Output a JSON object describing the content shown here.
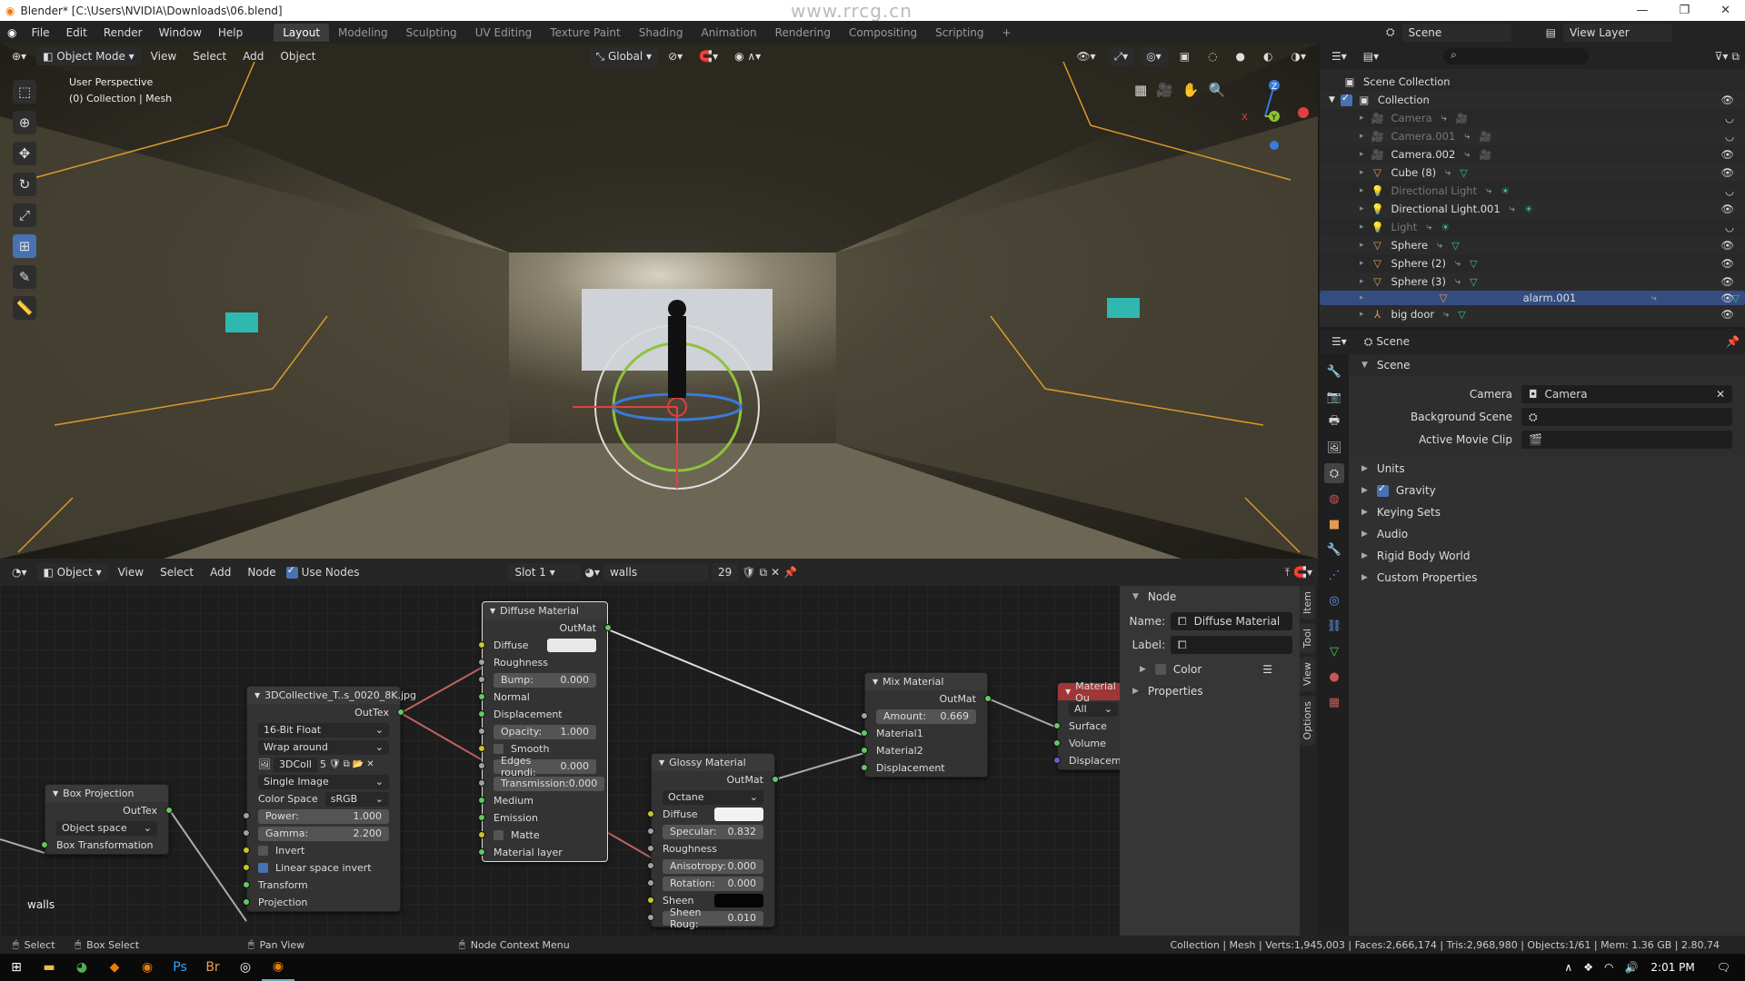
{
  "window": {
    "title": "Blender* [C:\\Users\\NVIDIA\\Downloads\\06.blend]",
    "watermark": "www.rrcg.cn"
  },
  "menu": [
    "File",
    "Edit",
    "Render",
    "Window",
    "Help"
  ],
  "workspaces": [
    "Layout",
    "Modeling",
    "Sculpting",
    "UV Editing",
    "Texture Paint",
    "Shading",
    "Animation",
    "Rendering",
    "Compositing",
    "Scripting",
    "+"
  ],
  "active_workspace": "Layout",
  "scene_selector": "Scene",
  "view_layer": "View Layer",
  "viewport": {
    "mode": "Object Mode",
    "menus": [
      "View",
      "Select",
      "Add",
      "Object"
    ],
    "orientation": "Global",
    "overlay_line1": "User Perspective",
    "overlay_line2": "(0) Collection | Mesh",
    "axes": {
      "x": "X",
      "y": "Y",
      "z": "Z"
    }
  },
  "outliner": {
    "root": "Scene Collection",
    "collection": "Collection",
    "items": [
      {
        "name": "Camera",
        "icon": "camera",
        "dim": true,
        "visible": false
      },
      {
        "name": "Camera.001",
        "icon": "camera",
        "dim": true,
        "visible": false
      },
      {
        "name": "Camera.002",
        "icon": "camera",
        "dim": false,
        "visible": true
      },
      {
        "name": "Cube (8)",
        "icon": "mesh",
        "dim": false,
        "visible": true
      },
      {
        "name": "Directional Light",
        "icon": "light",
        "dim": true,
        "visible": false
      },
      {
        "name": "Directional Light.001",
        "icon": "light",
        "dim": false,
        "visible": true
      },
      {
        "name": "Light",
        "icon": "light",
        "dim": true,
        "visible": false
      },
      {
        "name": "Sphere",
        "icon": "mesh",
        "dim": false,
        "visible": true
      },
      {
        "name": "Sphere (2)",
        "icon": "mesh",
        "dim": false,
        "visible": true
      },
      {
        "name": "Sphere (3)",
        "icon": "mesh",
        "dim": false,
        "visible": true
      },
      {
        "name": "alarm.001",
        "icon": "mesh",
        "dim": false,
        "visible": true,
        "selected": true
      },
      {
        "name": "big door",
        "icon": "empty",
        "dim": false,
        "visible": true
      }
    ]
  },
  "properties": {
    "context": "Scene",
    "section": "Scene",
    "fields": [
      {
        "label": "Camera",
        "value": "Camera",
        "icon": "camera-object-icon"
      },
      {
        "label": "Background Scene",
        "value": "",
        "icon": "scene-icon"
      },
      {
        "label": "Active Movie Clip",
        "value": "",
        "icon": "clip-icon"
      }
    ],
    "panels": [
      {
        "label": "Units",
        "checkbox": false
      },
      {
        "label": "Gravity",
        "checkbox": true
      },
      {
        "label": "Keying Sets",
        "checkbox": false
      },
      {
        "label": "Audio",
        "checkbox": false
      },
      {
        "label": "Rigid Body World",
        "checkbox": false
      },
      {
        "label": "Custom Properties",
        "checkbox": false
      }
    ]
  },
  "node_editor": {
    "type": "Object",
    "menus": [
      "View",
      "Select",
      "Add",
      "Node"
    ],
    "use_nodes_label": "Use Nodes",
    "use_nodes": true,
    "slot": "Slot 1",
    "material": "walls",
    "users": "29",
    "material_label": "walls",
    "npanel": {
      "section": "Node",
      "name_label": "Name:",
      "name": "Diffuse Material",
      "label_label": "Label:",
      "label": "",
      "color": "Color",
      "properties": "Properties",
      "tabs": [
        "Item",
        "Tool",
        "View",
        "Options"
      ]
    },
    "nodes": [
      {
        "id": "diffuse",
        "title": "Diffuse Material",
        "active": true,
        "header_color": "#3a3a3a",
        "rows": [
          {
            "t": "out",
            "label": "OutMat",
            "sock": "#63c763"
          },
          {
            "t": "color",
            "label": "Diffuse",
            "color": "#e8e8e8",
            "sock": "#c7c729"
          },
          {
            "t": "socket",
            "label": "Roughness",
            "sock": "#a1a1a1"
          },
          {
            "t": "field",
            "label": "Bump:",
            "value": "0.000",
            "sock": "#a1a1a1"
          },
          {
            "t": "socket",
            "label": "Normal",
            "sock": "#63c763"
          },
          {
            "t": "socket",
            "label": "Displacement",
            "sock": "#63c763"
          },
          {
            "t": "field",
            "label": "Opacity:",
            "value": "1.000",
            "sock": "#a1a1a1"
          },
          {
            "t": "check",
            "label": "Smooth",
            "checked": false,
            "sock": "#c7c729"
          },
          {
            "t": "field",
            "label": "Edges roundi:",
            "value": "0.000",
            "sock": "#a1a1a1"
          },
          {
            "t": "field",
            "label": "Transmission:",
            "value": "0.000",
            "sock": "#a1a1a1"
          },
          {
            "t": "socket",
            "label": "Medium",
            "sock": "#63c763"
          },
          {
            "t": "socket",
            "label": "Emission",
            "sock": "#63c763"
          },
          {
            "t": "check",
            "label": "Matte",
            "checked": false,
            "sock": "#c7c729"
          },
          {
            "t": "socket",
            "label": "Material layer",
            "sock": "#63c763"
          }
        ]
      },
      {
        "id": "image",
        "title": "3DCollective_T..s_0020_8K.jpg",
        "header_color": "#3a3a3a",
        "rows": [
          {
            "t": "out",
            "label": "OutTex",
            "sock": "#63c763"
          },
          {
            "t": "select",
            "value": "16-Bit Float"
          },
          {
            "t": "select",
            "value": "Wrap around"
          },
          {
            "t": "image",
            "value": "3DColl",
            "users": "5"
          },
          {
            "t": "select",
            "value": "Single Image"
          },
          {
            "t": "labelselect",
            "label": "Color Space",
            "value": "sRGB"
          },
          {
            "t": "field",
            "label": "Power:",
            "value": "1.000",
            "sock": "#a1a1a1"
          },
          {
            "t": "field",
            "label": "Gamma:",
            "value": "2.200",
            "sock": "#a1a1a1"
          },
          {
            "t": "check",
            "label": "Invert",
            "checked": false,
            "sock": "#c7c729"
          },
          {
            "t": "check",
            "label": "Linear space invert",
            "checked": true,
            "sock": "#c7c729"
          },
          {
            "t": "socket",
            "label": "Transform",
            "sock": "#63c763"
          },
          {
            "t": "socket",
            "label": "Projection",
            "sock": "#63c763"
          }
        ]
      },
      {
        "id": "box",
        "title": "Box Projection",
        "header_color": "#3a3a3a",
        "rows": [
          {
            "t": "out",
            "label": "OutTex",
            "sock": "#63c763"
          },
          {
            "t": "select",
            "value": "Object space"
          },
          {
            "t": "socket",
            "label": "Box Transformation",
            "sock": "#63c763"
          }
        ]
      },
      {
        "id": "glossy",
        "title": "Glossy Material",
        "header_color": "#3a3a3a",
        "rows": [
          {
            "t": "out",
            "label": "OutMat",
            "sock": "#63c763"
          },
          {
            "t": "select",
            "value": "Octane"
          },
          {
            "t": "color",
            "label": "Diffuse",
            "color": "#f2f2f2",
            "sock": "#c7c729"
          },
          {
            "t": "field",
            "label": "Specular:",
            "value": "0.832",
            "sock": "#a1a1a1"
          },
          {
            "t": "socket",
            "label": "Roughness",
            "sock": "#a1a1a1"
          },
          {
            "t": "field",
            "label": "Anisotropy:",
            "value": "0.000",
            "sock": "#a1a1a1"
          },
          {
            "t": "field",
            "label": "Rotation:",
            "value": "0.000",
            "sock": "#a1a1a1"
          },
          {
            "t": "color",
            "label": "Sheen",
            "color": "#050505",
            "sock": "#c7c729"
          },
          {
            "t": "field",
            "label": "Sheen Roug:",
            "value": "0.010",
            "sock": "#a1a1a1"
          }
        ]
      },
      {
        "id": "mix",
        "title": "Mix Material",
        "header_color": "#3a3a3a",
        "rows": [
          {
            "t": "out",
            "label": "OutMat",
            "sock": "#63c763"
          },
          {
            "t": "field",
            "label": "Amount:",
            "value": "0.669",
            "sock": "#a1a1a1"
          },
          {
            "t": "socket",
            "label": "Material1",
            "sock": "#63c763"
          },
          {
            "t": "socket",
            "label": "Material2",
            "sock": "#63c763"
          },
          {
            "t": "socket",
            "label": "Displacement",
            "sock": "#63c763"
          }
        ]
      },
      {
        "id": "matout",
        "title": "Material Ou",
        "header_color": "#a03636",
        "rows": [
          {
            "t": "select",
            "value": "All"
          },
          {
            "t": "socket",
            "label": "Surface",
            "sock": "#63c763"
          },
          {
            "t": "socket",
            "label": "Volume",
            "sock": "#63c763"
          },
          {
            "t": "socket",
            "label": "Displacemer",
            "sock": "#6363c7"
          }
        ]
      }
    ]
  },
  "statusbar": {
    "select": "Select",
    "box_select": "Box Select",
    "pan_view": "Pan View",
    "context_menu": "Node Context Menu",
    "stats": "Collection | Mesh | Verts:1,945,003 | Faces:2,666,174 | Tris:2,968,980 | Objects:1/61 | Mem: 1.36 GB | 2.80.74"
  },
  "taskbar": {
    "time": "2:01 PM"
  },
  "colors": {
    "accent": "#4772b3",
    "selected_row": "#334d80",
    "material_output": "#a03636"
  }
}
